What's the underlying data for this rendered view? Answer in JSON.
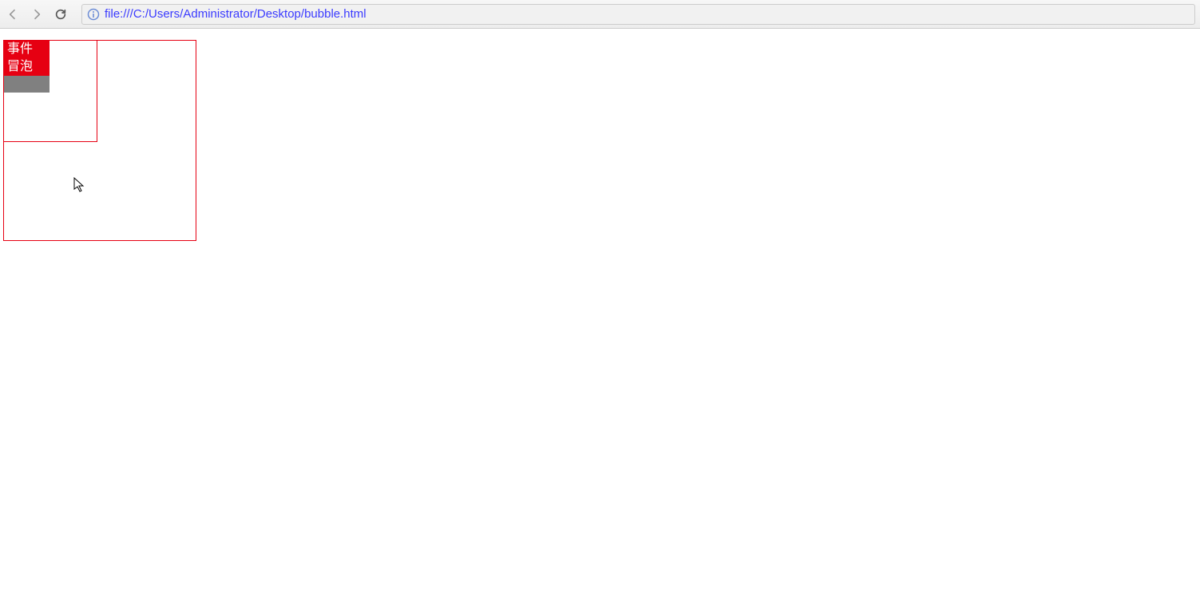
{
  "toolbar": {
    "url": "file:///C:/Users/Administrator/Desktop/bubble.html"
  },
  "page": {
    "inner_box_label_line1": "事件",
    "inner_box_label_line2": "冒泡"
  }
}
